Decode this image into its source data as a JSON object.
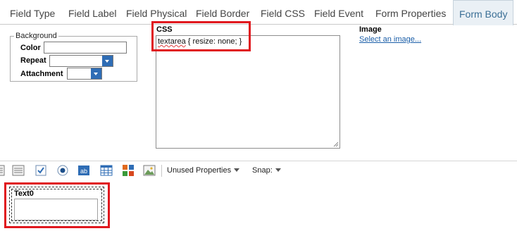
{
  "tabs": [
    {
      "label": "Field Type"
    },
    {
      "label": "Field Label"
    },
    {
      "label": "Field Physical"
    },
    {
      "label": "Field Border"
    },
    {
      "label": "Field CSS"
    },
    {
      "label": "Field Event"
    },
    {
      "label": "Form Properties"
    },
    {
      "label": "Form Body",
      "active": true
    }
  ],
  "background": {
    "legend": "Background",
    "color_label": "Color",
    "color_value": "",
    "repeat_label": "Repeat",
    "repeat_value": "",
    "attachment_label": "Attachment",
    "attachment_value": ""
  },
  "css": {
    "label": "CSS",
    "value_word": "textarea",
    "value_rest": " { resize: none; }"
  },
  "image": {
    "label": "Image",
    "link": "Select an image..."
  },
  "toolbar": {
    "icons": [
      "list-field-icon",
      "checkbox-field-icon",
      "radio-field-icon",
      "text-field-icon",
      "grid-field-icon",
      "palette-icon",
      "picture-icon"
    ],
    "text_field_glyph": "ab",
    "unused_properties": "Unused Properties",
    "snap": "Snap:"
  },
  "canvas": {
    "field_label": "Text0",
    "field_value": ""
  },
  "colors": {
    "accent": "#3b6f96",
    "highlight": "#e0181e",
    "dropdown_button": "#2f6db5",
    "link": "#1a5ea8"
  }
}
